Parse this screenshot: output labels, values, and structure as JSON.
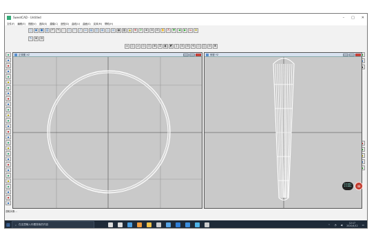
{
  "window": {
    "title": "SweetCAD - Untitled",
    "min": "–",
    "max": "□",
    "close": "✕"
  },
  "menu": [
    "文件(F)",
    "编辑(E)",
    "视图(V)",
    "选择(S)",
    "建模(C)",
    "造型(D)",
    "曲线(U)",
    "曲面(S)",
    "实体(M)",
    "帮助(H)"
  ],
  "toolbar_main": [
    {
      "icon": "new-icon",
      "glyph": "□",
      "tone": "c1"
    },
    {
      "icon": "open-icon",
      "glyph": "▣",
      "tone": "c1"
    },
    {
      "icon": "save-icon",
      "glyph": "■",
      "tone": "c1"
    },
    {
      "icon": "print-icon",
      "glyph": "⎙",
      "tone": "c1"
    },
    {
      "icon": "undo-icon",
      "glyph": "↶",
      "tone": ""
    },
    {
      "icon": "redo-icon",
      "glyph": "↷",
      "tone": ""
    },
    {
      "icon": "point-icon",
      "glyph": "·",
      "tone": "c2"
    },
    {
      "icon": "circle-icon",
      "glyph": "○",
      "tone": "c1"
    },
    {
      "icon": "arc-icon",
      "glyph": "◠",
      "tone": "c1"
    },
    {
      "icon": "line-icon",
      "glyph": "╱",
      "tone": "c1"
    },
    {
      "icon": "rect-icon",
      "glyph": "▭",
      "tone": "c1"
    },
    {
      "icon": "box-icon",
      "glyph": "▤",
      "tone": "c1"
    },
    {
      "icon": "cylinder-icon",
      "glyph": "◫",
      "tone": "c1"
    },
    {
      "icon": "sphere-icon",
      "glyph": "◍",
      "tone": "c1"
    },
    {
      "icon": "cone-icon",
      "glyph": "△",
      "tone": "c1"
    },
    {
      "icon": "torus-icon",
      "glyph": "◎",
      "tone": "c1"
    },
    {
      "icon": "grid-icon",
      "glyph": "▦",
      "tone": ""
    },
    {
      "icon": "layer-icon",
      "glyph": "▥",
      "tone": ""
    },
    {
      "icon": "warn-icon",
      "glyph": "▲",
      "tone": "c4"
    },
    {
      "icon": "move-icon",
      "glyph": "✥",
      "tone": "c2"
    },
    {
      "icon": "rotate-icon",
      "glyph": "⟳",
      "tone": "c3"
    },
    {
      "icon": "zoom-in-icon",
      "glyph": "⊕",
      "tone": ""
    },
    {
      "icon": "zoom-out-icon",
      "glyph": "⊖",
      "tone": ""
    },
    {
      "icon": "zoom-fit-icon",
      "glyph": "⊡",
      "tone": ""
    },
    {
      "icon": "pan-icon",
      "glyph": "✋",
      "tone": ""
    },
    {
      "icon": "text-icon",
      "glyph": "A",
      "tone": "c2"
    },
    {
      "icon": "down-icon",
      "glyph": "▼",
      "tone": "c3"
    },
    {
      "icon": "left-icon",
      "glyph": "◀",
      "tone": "c3"
    },
    {
      "icon": "right-icon",
      "glyph": "▶",
      "tone": "c3"
    },
    {
      "icon": "mirror-icon",
      "glyph": "⇋",
      "tone": "c2"
    },
    {
      "icon": "render-icon",
      "glyph": "✿",
      "tone": "c4"
    }
  ],
  "toolbar_sub": [
    {
      "icon": "snap-icon",
      "glyph": "✎",
      "tone": "c1"
    },
    {
      "icon": "ortho-icon",
      "glyph": "⊞",
      "tone": ""
    },
    {
      "icon": "layer2-icon",
      "glyph": "⊟",
      "tone": ""
    }
  ],
  "toolbar_view": [
    {
      "icon": "view-front-icon",
      "glyph": "▭",
      "tone": ""
    },
    {
      "icon": "view-side-icon",
      "glyph": "▯",
      "tone": ""
    },
    {
      "icon": "view-top-icon",
      "glyph": "▱",
      "tone": ""
    },
    {
      "icon": "view-iso-icon",
      "glyph": "◇",
      "tone": ""
    },
    {
      "icon": "view-persp-icon",
      "glyph": "⬡",
      "tone": ""
    },
    {
      "icon": "view-4-icon",
      "glyph": "⊞",
      "tone": ""
    },
    {
      "icon": "view-wire-icon",
      "glyph": "⌗",
      "tone": ""
    },
    {
      "icon": "view-shade-icon",
      "glyph": "◧",
      "tone": ""
    },
    {
      "icon": "view-hidden-icon",
      "glyph": "◩",
      "tone": ""
    },
    {
      "icon": "view-sep-icon",
      "glyph": "|",
      "tone": ""
    },
    {
      "icon": "view-orbit-icon",
      "glyph": "⊙",
      "tone": ""
    },
    {
      "icon": "view-fit-icon",
      "glyph": "⊡",
      "tone": ""
    },
    {
      "icon": "view-reset-icon",
      "glyph": "⟲",
      "tone": ""
    },
    {
      "icon": "view-circle-icon",
      "glyph": "○",
      "tone": ""
    },
    {
      "icon": "view-box-icon",
      "glyph": "□",
      "tone": ""
    },
    {
      "icon": "view-pt-icon",
      "glyph": "⊙",
      "tone": ""
    },
    {
      "icon": "view-grid-icon",
      "glyph": "⌸",
      "tone": ""
    }
  ],
  "left_tools": [
    "sketch-icon",
    "line-tool-icon",
    "poly-icon",
    "arc-tool-icon",
    "circle-tool-icon",
    "spline-icon",
    "curve-icon",
    "offset-icon",
    "trim-icon",
    "extend-icon",
    "fillet-icon",
    "chamfer-icon",
    "mirror-tool-icon",
    "array-icon",
    "project-icon",
    "extrude-icon",
    "revolve-icon",
    "sweep-icon",
    "loft-icon",
    "blend-icon",
    "shell-icon",
    "boolean-icon",
    "split-icon",
    "measure-icon",
    "dim-icon",
    "note-icon",
    "hatch-icon",
    "layer-tool-icon"
  ],
  "right_tools": [
    "palette-icon",
    "select-icon",
    "cursor-icon",
    "cut-icon",
    "paint-icon",
    "color-icon",
    "wire-icon",
    "light-icon"
  ],
  "views": {
    "left": {
      "title": "正视图 XZ"
    },
    "right": {
      "title": "侧视 YZ"
    }
  },
  "status": "选取对象...",
  "taskbar": {
    "search_placeholder": "在这里输入你要搜索的内容",
    "apps": [
      "cortana-icon",
      "taskview-icon",
      "chrome-icon",
      "firefox-icon",
      "explorer-icon",
      "store-icon",
      "mail-icon",
      "edge-icon",
      "settings-icon",
      "photos-icon",
      "cad-app-icon"
    ],
    "app_colors": [
      "#ddd",
      "#ddd",
      "#4a9de0",
      "#f39c3c",
      "#f2c34a",
      "#ccc",
      "#58a6e8",
      "#2f7fd8",
      "#3c8fe0",
      "#4fb3e8",
      "#ccc"
    ],
    "time": "12:17",
    "date": "2020/4/12"
  },
  "badge": {
    "line1": "0.0 KB/s",
    "line2": "2.5 KB/s",
    "value": "48"
  }
}
